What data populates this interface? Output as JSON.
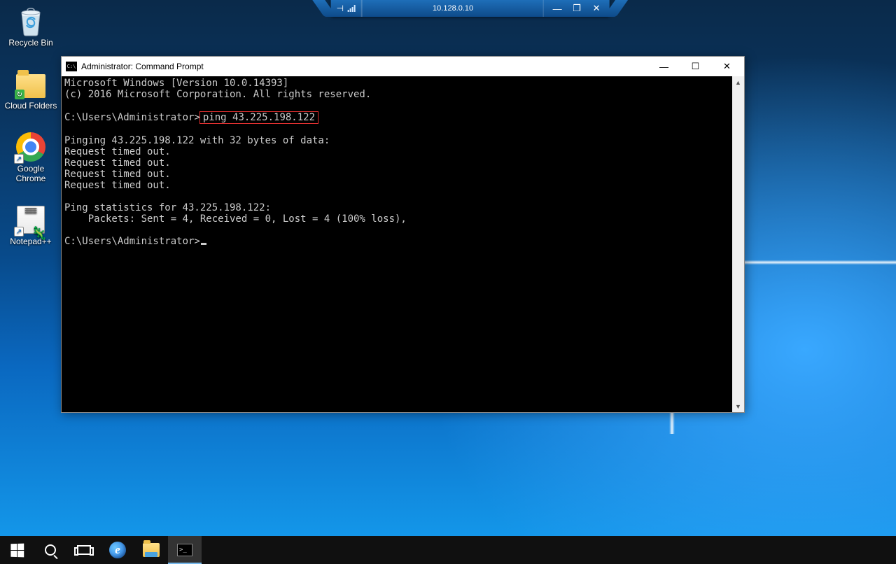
{
  "remote_bar": {
    "ip": "10.128.0.10"
  },
  "desktop": {
    "recycle": "Recycle Bin",
    "cloud": "Cloud Folders",
    "chrome": "Google Chrome",
    "npp": "Notepad++"
  },
  "cmd": {
    "title": "Administrator: Command Prompt",
    "line_ver": "Microsoft Windows [Version 10.0.14393]",
    "line_copy": "(c) 2016 Microsoft Corporation. All rights reserved.",
    "prompt1_pre": "C:\\Users\\Administrator>",
    "prompt1_cmd": "ping 43.225.198.122",
    "ping_header": "Pinging 43.225.198.122 with 32 bytes of data:",
    "timeout": "Request timed out.",
    "stats_hdr": "Ping statistics for 43.225.198.122:",
    "stats_pkts": "    Packets: Sent = 4, Received = 0, Lost = 4 (100% loss),",
    "prompt2": "C:\\Users\\Administrator>"
  }
}
